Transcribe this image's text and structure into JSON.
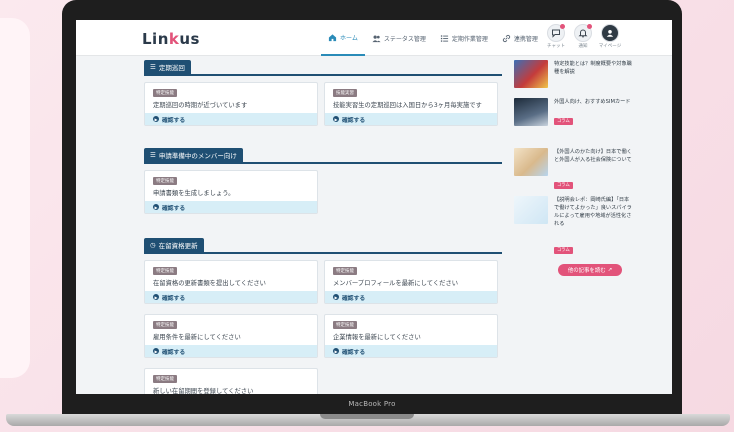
{
  "device": {
    "label": "MacBook Pro"
  },
  "header": {
    "logo_left": "Lin",
    "logo_accent": "k",
    "logo_right": "us",
    "nav": [
      {
        "label": "ホーム",
        "icon": "home-icon"
      },
      {
        "label": "ステータス管理",
        "icon": "users-icon"
      },
      {
        "label": "定期作業管理",
        "icon": "list-icon"
      },
      {
        "label": "連携管理",
        "icon": "link-icon"
      }
    ],
    "icons": [
      {
        "label": "チャット",
        "icon": "chat-icon"
      },
      {
        "label": "通知",
        "icon": "bell-icon"
      },
      {
        "label": "マイページ",
        "icon": "user-icon"
      }
    ]
  },
  "sections": {
    "periodic": {
      "title": "定期巡回"
    },
    "applicants": {
      "title": "申請準備中のメンバー向け"
    },
    "renewal": {
      "title": "在留資格更新"
    }
  },
  "cards": {
    "action_label": "確認する",
    "c1": {
      "badge": "特定技能",
      "text": "定期巡回の時期が近づいています"
    },
    "c2": {
      "badge": "技能実習",
      "text": "技能実習生の定期巡回は入国日から3ヶ月毎実施です"
    },
    "c3": {
      "badge": "特定技能",
      "text": "申請書類を生成しましょう。"
    },
    "c4": {
      "badge": "特定技能",
      "text": "在留資格の更新書類を提出してください"
    },
    "c5": {
      "badge": "特定技能",
      "text": "メンバープロフィールを最新にしてください"
    },
    "c6": {
      "badge": "特定技能",
      "text": "雇用条件を最新にしてください"
    },
    "c7": {
      "badge": "特定技能",
      "text": "企業情報を最新にしてください"
    },
    "c8": {
      "badge": "特定技能",
      "text": "新しい在留期間を登録してください"
    }
  },
  "sidebar": {
    "articles": [
      {
        "title": "特定技能とは？制度概要や対象職種を解説",
        "tag": ""
      },
      {
        "title": "外国人向け、おすすめSIMカード",
        "tag": "コラム"
      },
      {
        "title": "【外国人のかた向け】日本で働くと外国人が入る社会保険について",
        "tag": "コラム"
      },
      {
        "title": "【説明会レポ：岡崎氏編】「日本で働けてよかった」良いスパイラルによって雇用や地域が活性化される",
        "tag": "コラム"
      }
    ],
    "more_button": "他の記事を読む"
  }
}
